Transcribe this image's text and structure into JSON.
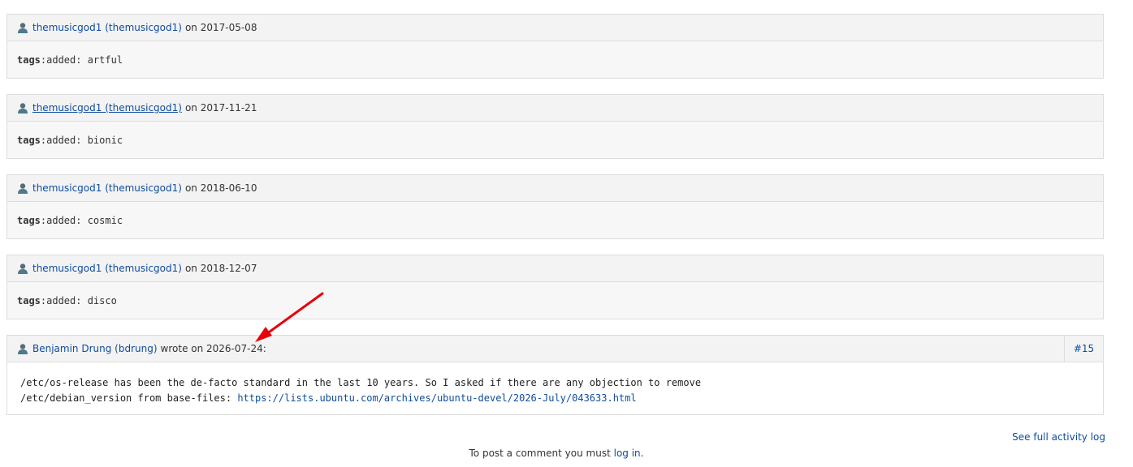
{
  "entries": [
    {
      "user": "themusicgod1 (themusicgod1)",
      "date_text": "on 2017-05-08",
      "tag_key": "tags",
      "tag_change": ":added: artful"
    },
    {
      "user": "themusicgod1 (themusicgod1)",
      "date_text": "on 2017-11-21",
      "tag_key": "tags",
      "tag_change": ":added: bionic"
    },
    {
      "user": "themusicgod1 (themusicgod1)",
      "date_text": "on 2018-06-10",
      "tag_key": "tags",
      "tag_change": ":added: cosmic"
    },
    {
      "user": "themusicgod1 (themusicgod1)",
      "date_text": "on 2018-12-07",
      "tag_key": "tags",
      "tag_change": ":added: disco"
    }
  ],
  "comment": {
    "user": "Benjamin Drung (bdrung)",
    "date_text": "wrote on 2026-07-24:",
    "number": "#15",
    "line1": "/etc/os-release has been the de-facto standard in the last 10 years. So I asked if there are any objection to remove",
    "line2_prefix": "/etc/debian_version from base-files: ",
    "link": "https://lists.ubuntu.com/archives/ubuntu-devel/2026-July/043633.html"
  },
  "footer": {
    "activity_log": "See full activity log",
    "post_prefix": "To post a comment you must ",
    "login": "log in",
    "post_suffix": "."
  },
  "colors": {
    "link": "#0e4c9e",
    "annotation_arrow": "#e8000b"
  }
}
